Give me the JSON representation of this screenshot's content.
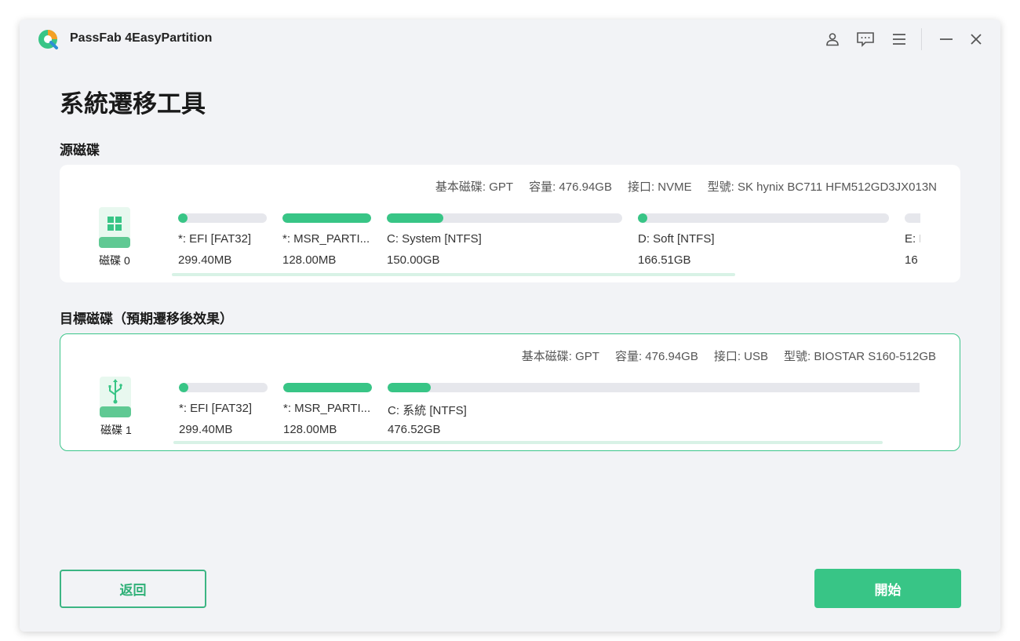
{
  "app": {
    "title": "PassFab 4EasyPartition"
  },
  "titlebar": {
    "icons": [
      "user-icon",
      "feedback-icon",
      "menu-icon",
      "minimize-icon",
      "close-icon"
    ]
  },
  "page": {
    "title": "系統遷移工具"
  },
  "source": {
    "section_title": "源磁碟",
    "disk_label": "磁碟 0",
    "info": {
      "type": "基本磁碟: GPT",
      "capacity": "容量: 476.94GB",
      "interface": "接口: NVME",
      "model": "型號: SK hynix BC711 HFM512GD3JX013N"
    },
    "partitions": [
      {
        "name": "*: EFI [FAT32]",
        "size": "299.40MB",
        "used": 0.05
      },
      {
        "name": "*: MSR_PARTI...",
        "size": "128.00MB",
        "used": 1.0
      },
      {
        "name": "C: System [NTFS]",
        "size": "150.00GB",
        "used": 0.24
      },
      {
        "name": "D: Soft [NTFS]",
        "size": "166.51GB",
        "used": 0.02
      },
      {
        "name": "E: I",
        "size": "16",
        "used": 0.0
      }
    ]
  },
  "target": {
    "section_title": "目標磁碟（預期遷移後效果）",
    "disk_label": "磁碟 1",
    "info": {
      "type": "基本磁碟: GPT",
      "capacity": "容量: 476.94GB",
      "interface": "接口: USB",
      "model": "型號: BIOSTAR S160-512GB"
    },
    "partitions": [
      {
        "name": "*: EFI [FAT32]",
        "size": "299.40MB",
        "used": 0.05
      },
      {
        "name": "*: MSR_PARTI...",
        "size": "128.00MB",
        "used": 1.0
      },
      {
        "name": "C: 系統 [NTFS]",
        "size": "476.52GB",
        "used": 0.08
      }
    ]
  },
  "footer": {
    "back_label": "返回",
    "start_label": "開始"
  },
  "colors": {
    "accent": "#38c586",
    "track": "#e6e7ec",
    "scroll": "#d8f2e6"
  }
}
